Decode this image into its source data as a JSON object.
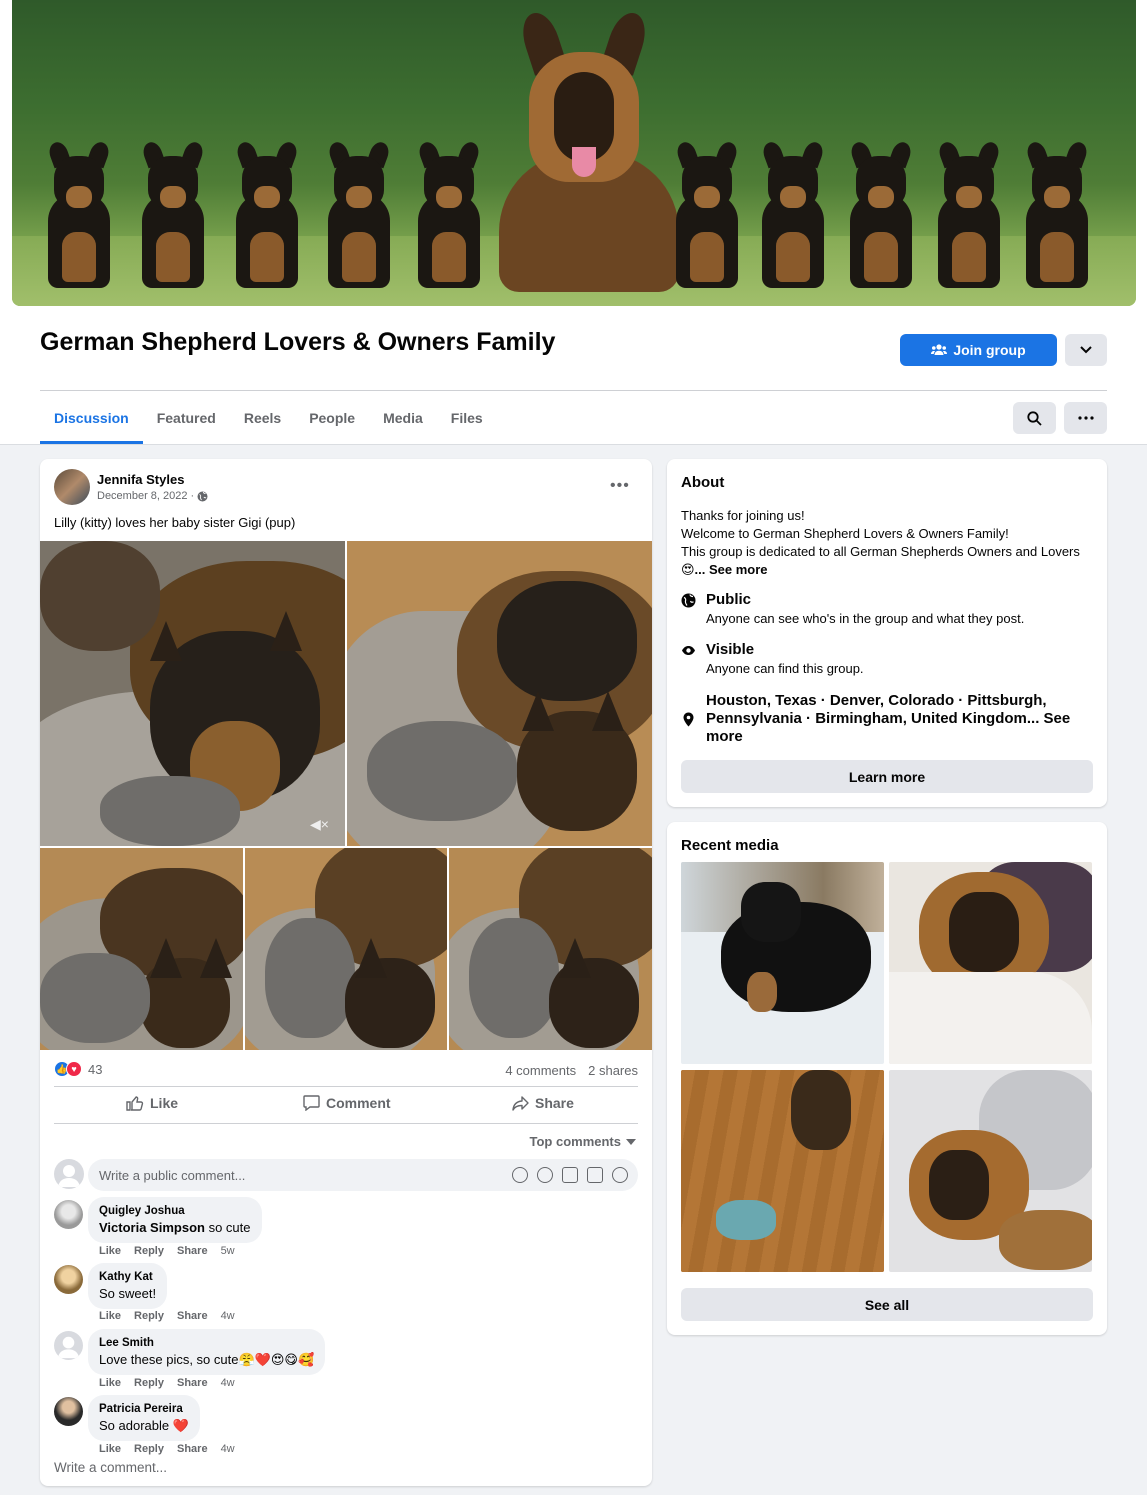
{
  "group": {
    "title": "German Shepherd Lovers & Owners Family",
    "join_label": "Join group"
  },
  "tabs": [
    "Discussion",
    "Featured",
    "Reels",
    "People",
    "Media",
    "Files"
  ],
  "post": {
    "author": "Jennifa Styles",
    "date": "December 8, 2022 ·",
    "text": "Lilly (kitty) loves her baby sister Gigi (pup)",
    "reaction_count": "43",
    "comments_count": "4 comments",
    "shares_count": "2 shares",
    "actions": {
      "like": "Like",
      "comment": "Comment",
      "share": "Share"
    },
    "top_comments": "Top comments",
    "write_placeholder": "Write a public comment...",
    "write_more": "Write a comment..."
  },
  "comments": [
    {
      "name": "Quigley Joshua",
      "mention": "Victoria Simpson",
      "text": " so cute",
      "time": "5w"
    },
    {
      "name": "Kathy Kat",
      "mention": "",
      "text": "So sweet!",
      "time": "4w"
    },
    {
      "name": "Lee Smith",
      "mention": "",
      "text": "Love these pics, so cute😤❤️😍😋🥰",
      "time": "4w"
    },
    {
      "name": "Patricia Pereira",
      "mention": "",
      "text": "So adorable ❤️",
      "time": "4w"
    }
  ],
  "comment_actions": {
    "like": "Like",
    "reply": "Reply",
    "share": "Share"
  },
  "about": {
    "heading": "About",
    "line1": "Thanks for joining us!",
    "line2": "Welcome to German Shepherd Lovers & Owners Family!",
    "line3": "This group is dedicated to all German Shepherds Owners and Lovers",
    "see_more": "😍... See more",
    "public_title": "Public",
    "public_sub": "Anyone can see who's in the group and what they post.",
    "visible_title": "Visible",
    "visible_sub": "Anyone can find this group.",
    "locations": "Houston, Texas · Denver, Colorado · Pittsburgh, Pennsylvania · Birmingham, United Kingdom... See more",
    "learn_more": "Learn more"
  },
  "media": {
    "heading": "Recent media",
    "see_all": "See all"
  },
  "colors": {
    "accent": "#1b74e4",
    "page_bg": "#f0f2f5",
    "button_gray": "#e4e6eb",
    "muted_text": "#65676b"
  }
}
